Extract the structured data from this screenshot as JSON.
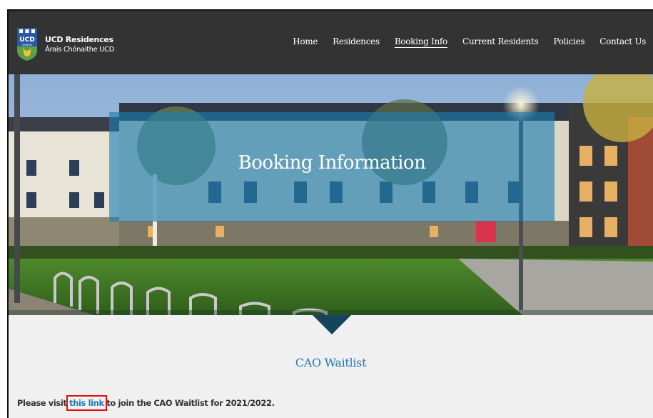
{
  "site": {
    "name": "UCD Residences",
    "subtitle": "Árais Chónaithe UCD",
    "logo_letters": "UCD",
    "logo_sub": "DUBLIN"
  },
  "nav": {
    "items": [
      {
        "label": "Home"
      },
      {
        "label": "Residences"
      },
      {
        "label": "Booking Info"
      },
      {
        "label": "Current Residents"
      },
      {
        "label": "Policies"
      },
      {
        "label": "Contact Us"
      }
    ],
    "active": "Booking Info"
  },
  "hero": {
    "title": "Booking Information",
    "icon": "campus-photo"
  },
  "content": {
    "section_title": "CAO Waitlist",
    "text_before": "Please visit ",
    "link_text": "this link",
    "text_after": " to join the CAO Waitlist for 2021/2022."
  },
  "colors": {
    "header_bg": "#333333",
    "accent_blue": "#1f7ab0",
    "highlight": "#e01010",
    "page_bg": "#f0f0f0"
  }
}
